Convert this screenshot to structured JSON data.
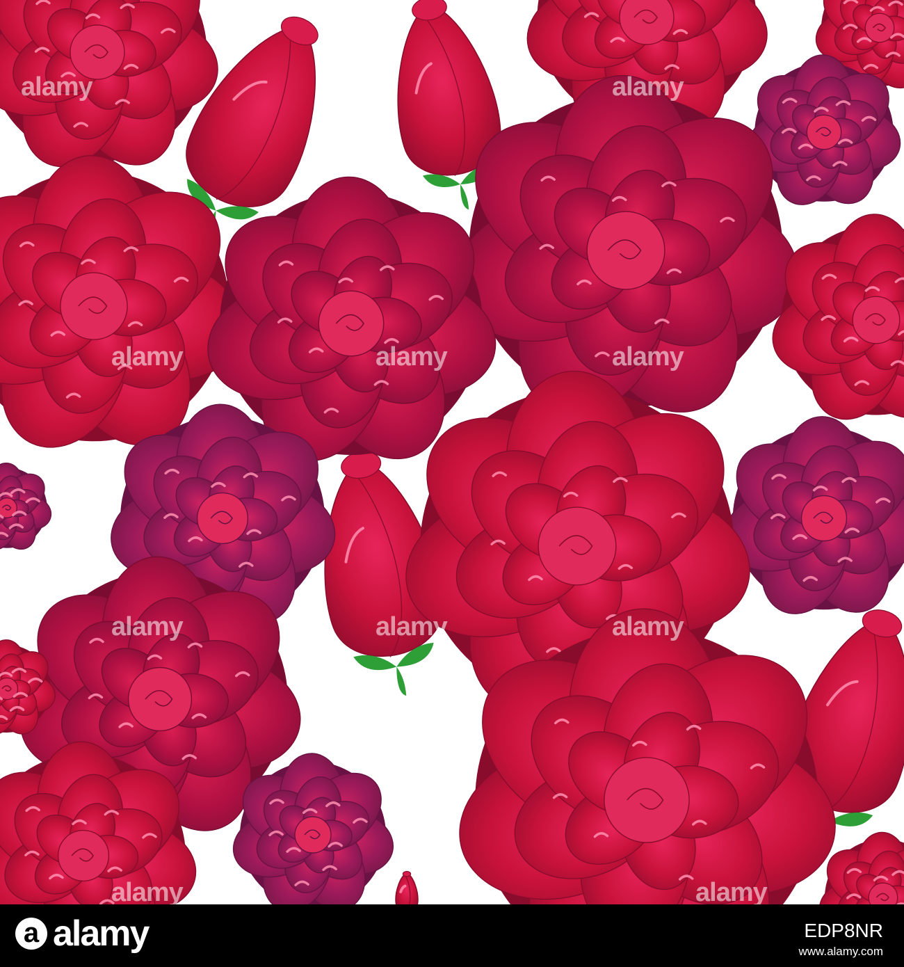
{
  "image": {
    "subject": "seamless pattern",
    "watermark_text": "alamy",
    "colors": {
      "background": "#ffffff",
      "petal_red": "#c8123a",
      "petal_crimson": "#a5103f",
      "petal_purple": "#8e1a55",
      "leaf_green": "#2e9e36",
      "footer_bg": "#000000"
    }
  },
  "footer": {
    "logo_mark": "a",
    "logo_word": "alamy",
    "image_id": "EDP8NR",
    "url": "www.alamy.com"
  }
}
